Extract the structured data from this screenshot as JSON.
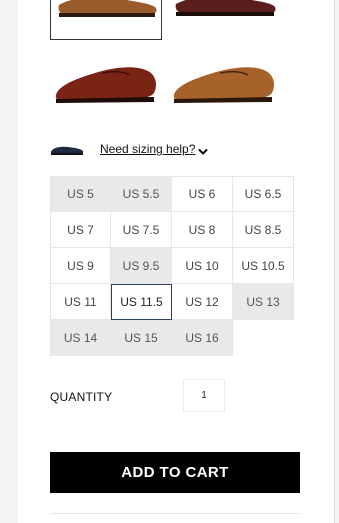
{
  "thumbnails": [
    {
      "name": "thumbnail-top-left",
      "color": "#9a5a2a",
      "selected": true
    },
    {
      "name": "thumbnail-top-right",
      "color": "#5a1f1c",
      "selected": false
    },
    {
      "name": "thumbnail-bottom-left",
      "color": "#7a2416",
      "selected": false
    },
    {
      "name": "thumbnail-bottom-right",
      "color": "#a5622a",
      "selected": false
    }
  ],
  "sizing": {
    "link_label": "Need sizing help?",
    "icon": "shoe-icon",
    "chevron": "chevron-down-icon"
  },
  "sizes": [
    {
      "label": "US 5",
      "available": false,
      "selected": false
    },
    {
      "label": "US 5.5",
      "available": false,
      "selected": false
    },
    {
      "label": "US 6",
      "available": true,
      "selected": false
    },
    {
      "label": "US 6.5",
      "available": true,
      "selected": false
    },
    {
      "label": "US 7",
      "available": true,
      "selected": false
    },
    {
      "label": "US 7.5",
      "available": true,
      "selected": false
    },
    {
      "label": "US 8",
      "available": true,
      "selected": false
    },
    {
      "label": "US 8.5",
      "available": true,
      "selected": false
    },
    {
      "label": "US 9",
      "available": true,
      "selected": false
    },
    {
      "label": "US 9.5",
      "available": false,
      "selected": false
    },
    {
      "label": "US 10",
      "available": true,
      "selected": false
    },
    {
      "label": "US 10.5",
      "available": true,
      "selected": false
    },
    {
      "label": "US 11",
      "available": true,
      "selected": false
    },
    {
      "label": "US 11.5",
      "available": true,
      "selected": true
    },
    {
      "label": "US 12",
      "available": true,
      "selected": false
    },
    {
      "label": "US 13",
      "available": false,
      "selected": false
    },
    {
      "label": "US 14",
      "available": false,
      "selected": false
    },
    {
      "label": "US 15",
      "available": false,
      "selected": false
    },
    {
      "label": "US 16",
      "available": false,
      "selected": false
    }
  ],
  "quantity": {
    "label": "QUANTITY",
    "value": "1"
  },
  "cart": {
    "button_label": "ADD TO CART"
  },
  "colors": {
    "button_bg": "#000000",
    "unavailable_bg": "#e9e9e9",
    "selected_border": "#2c3e63"
  }
}
